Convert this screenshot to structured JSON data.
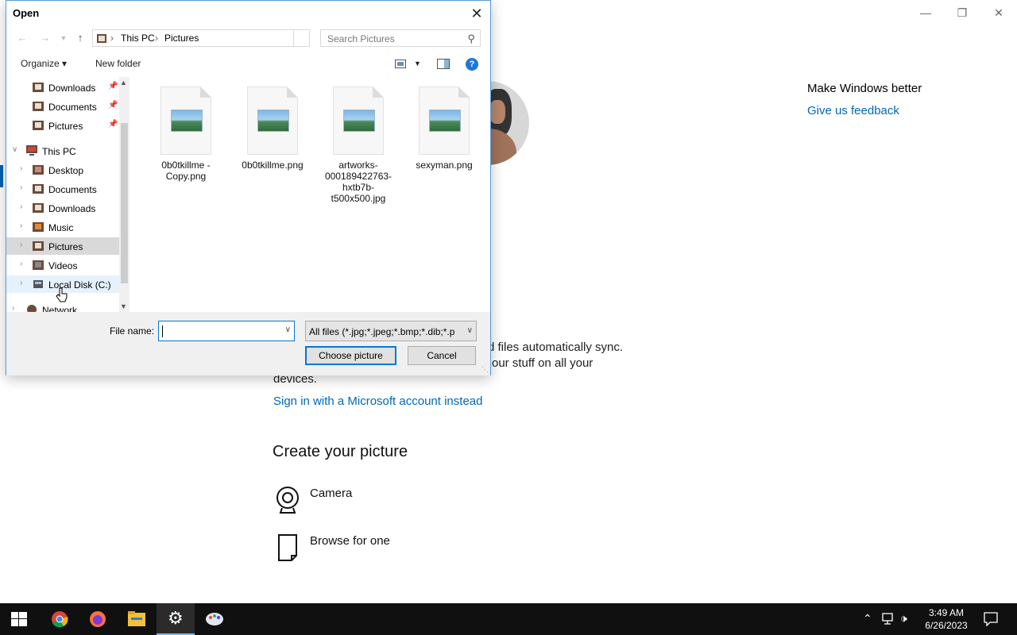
{
  "settings": {
    "side_title": "Make Windows better",
    "side_link": "Give us feedback",
    "body_line1": "d files automatically sync.",
    "body_line2": "our stuff on all your",
    "body_line3": "devices.",
    "signin_link": "Sign in with a Microsoft account instead",
    "section_title": "Create your picture",
    "options": [
      {
        "label": "Camera",
        "icon": "webcam-icon"
      },
      {
        "label": "Browse for one",
        "icon": "document-icon"
      }
    ],
    "window_controls": [
      "minimize",
      "restore",
      "close"
    ]
  },
  "dialog": {
    "title": "Open",
    "address": [
      "This PC",
      "Pictures"
    ],
    "search_placeholder": "Search Pictures",
    "toolbar": {
      "organize": "Organize",
      "new_folder": "New folder",
      "help": "?"
    },
    "quick_access": [
      {
        "label": "Downloads",
        "pinned": true
      },
      {
        "label": "Documents",
        "pinned": true
      },
      {
        "label": "Pictures",
        "pinned": true
      }
    ],
    "this_pc": {
      "label": "This PC",
      "children": [
        "Desktop",
        "Documents",
        "Downloads",
        "Music",
        "Pictures",
        "Videos",
        "Local Disk (C:)"
      ]
    },
    "network": "Network",
    "files": [
      {
        "name": "0b0tkillme - Copy.png"
      },
      {
        "name": "0b0tkillme.png"
      },
      {
        "name": "artworks-000189422763-hxtb7b-t500x500.jpg"
      },
      {
        "name": "sexyman.png"
      }
    ],
    "file_name_label": "File name:",
    "file_name_value": "",
    "file_type_filter": "All files (*.jpg;*.jpeg;*.bmp;*.dib;*.p",
    "choose_button": "Choose picture",
    "cancel_button": "Cancel"
  },
  "taskbar": {
    "apps": [
      "start",
      "chrome",
      "firefox",
      "file-explorer",
      "settings",
      "paint"
    ],
    "active_app": "settings",
    "time": "3:49 AM",
    "date": "6/26/2023"
  }
}
